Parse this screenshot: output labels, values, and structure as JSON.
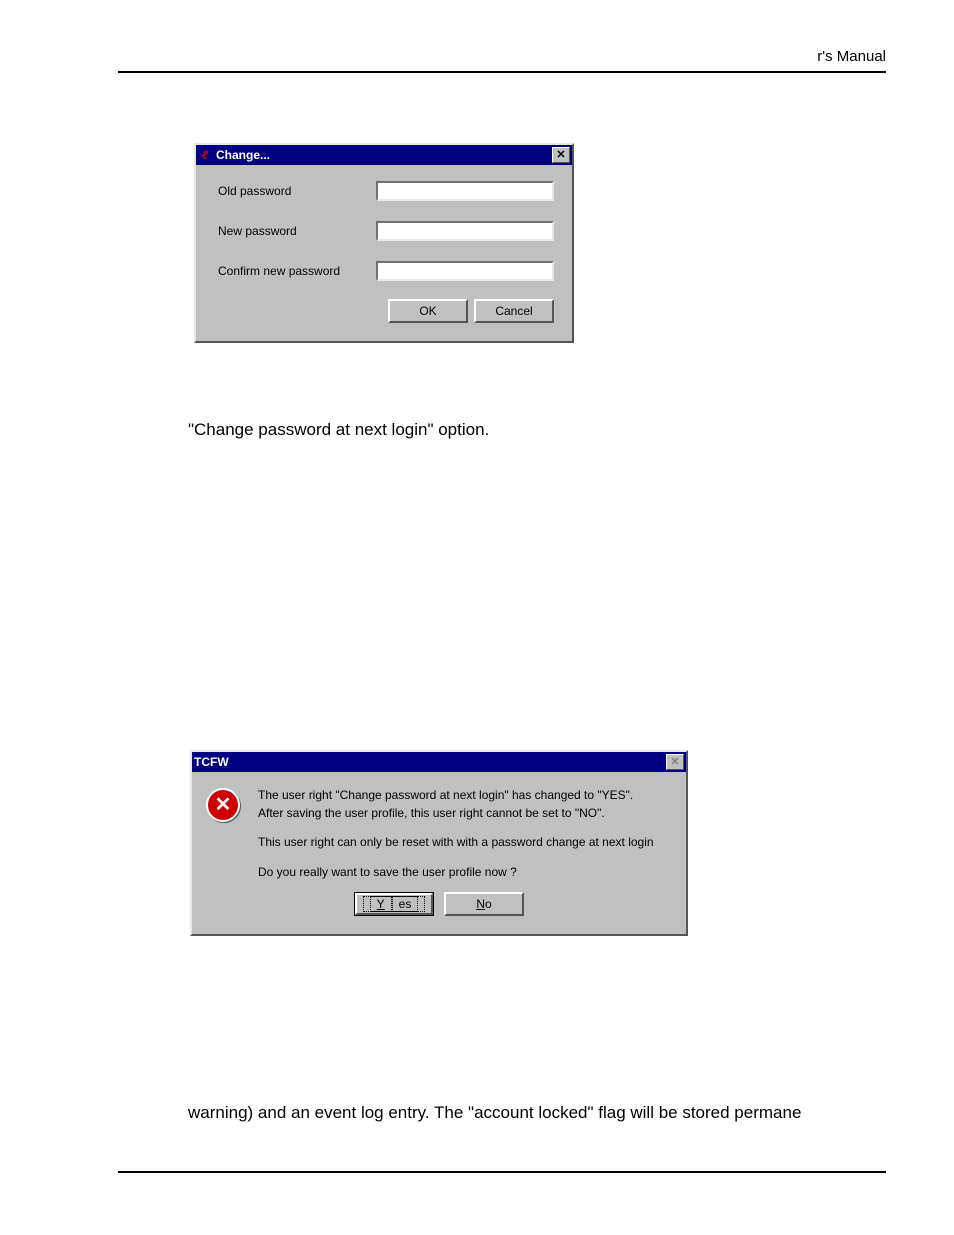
{
  "header": {
    "text": "r's Manual"
  },
  "dialog1": {
    "title": "Change...",
    "labels": {
      "old": "Old password",
      "new": "New password",
      "confirm": "Confirm new password"
    },
    "buttons": {
      "ok": "OK",
      "cancel": "Cancel"
    }
  },
  "body": {
    "line1": "\"Change password at next login\" option.",
    "line2": "warning) and an event log entry. The \"account locked\" flag will be stored permane"
  },
  "dialog2": {
    "title": "TCFW",
    "lines": {
      "l1": "The user right \"Change password at next login\" has changed to \"YES\".",
      "l2": "After saving the user profile, this user right cannot be set to \"NO\".",
      "l3": "This user right can only be reset with with a password change at next login",
      "l4": "Do you really want to save the user profile now ?"
    },
    "buttons": {
      "yes_mn": "Y",
      "yes_rest": "es",
      "no_mn": "N",
      "no_rest": "o"
    }
  }
}
